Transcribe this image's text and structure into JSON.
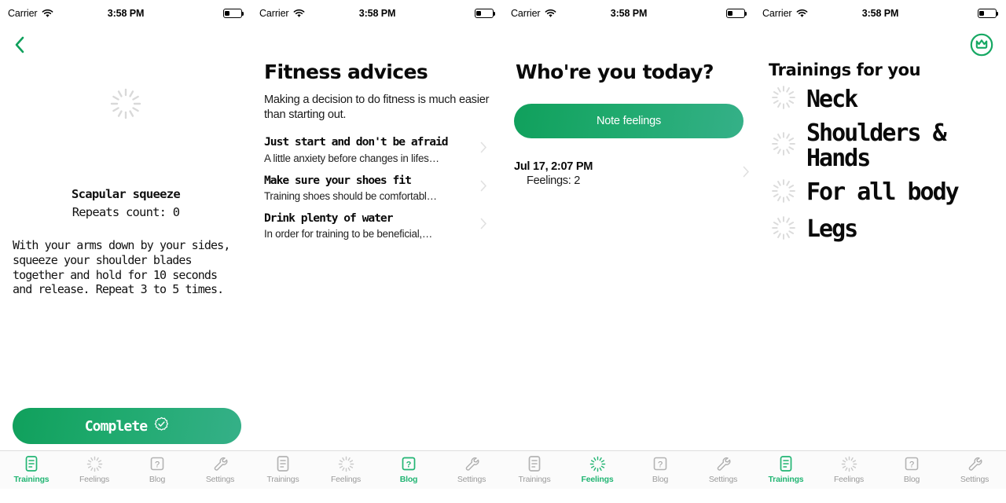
{
  "status_bar": {
    "carrier": "Carrier",
    "time": "3:58 PM",
    "wifi_icon": "wifi-icon",
    "battery_icon": "battery-low-icon"
  },
  "accent": {
    "green": "#22b573",
    "green_dark": "#10a05c",
    "green_light": "#35b088",
    "gray_text": "#9b9b9b"
  },
  "tab_bar": {
    "items": [
      {
        "label": "Trainings",
        "icon": "document-icon"
      },
      {
        "label": "Feelings",
        "icon": "spinner-circle-icon"
      },
      {
        "label": "Blog",
        "icon": "question-box-icon"
      },
      {
        "label": "Settings",
        "icon": "wrench-icon"
      }
    ]
  },
  "screens": [
    {
      "id": "exercise-detail",
      "active_tab": "Trainings",
      "nav": {
        "back_icon": "chevron-left-icon"
      },
      "media_icon": "loading-spinner-icon",
      "exercise_title": "Scapular squeeze",
      "repeats": "Repeats count: 0",
      "description": "With your arms down by your sides, squeeze your shoulder blades together and hold for 10 seconds and release. Repeat 3 to 5 times.",
      "complete_button": {
        "label": "Complete",
        "icon": "check-seal-icon"
      }
    },
    {
      "id": "blog",
      "active_tab": "Blog",
      "title": "Fitness advices",
      "intro": "Making a decision to do fitness is much easier than starting out.",
      "advices": [
        {
          "title": "Just start and don't be afraid",
          "subtitle": "A little anxiety before changes in lifes…",
          "chevron": "chevron-right-icon"
        },
        {
          "title": "Make sure your shoes fit",
          "subtitle": "Training shoes should be comfortabl…",
          "chevron": "chevron-right-icon"
        },
        {
          "title": "Drink plenty of water",
          "subtitle": "In order for training to be beneficial,…",
          "chevron": "chevron-right-icon"
        }
      ]
    },
    {
      "id": "feelings",
      "active_tab": "Feelings",
      "title": "Who're you today?",
      "note_button": {
        "label": "Note feelings"
      },
      "entries": [
        {
          "date": "Jul 17, 2:07 PM",
          "count": "Feelings: 2",
          "chevron": "chevron-right-icon"
        }
      ]
    },
    {
      "id": "trainings",
      "active_tab": "Trainings",
      "title": "Trainings for you",
      "nav": {
        "badge_icon": "crown-circle-icon"
      },
      "trainings": [
        {
          "label": "Neck",
          "icon": "loading-spinner-icon"
        },
        {
          "label": "Shoulders & Hands",
          "icon": "loading-spinner-icon"
        },
        {
          "label": "For all body",
          "icon": "loading-spinner-icon"
        },
        {
          "label": "Legs",
          "icon": "loading-spinner-icon"
        }
      ]
    }
  ]
}
